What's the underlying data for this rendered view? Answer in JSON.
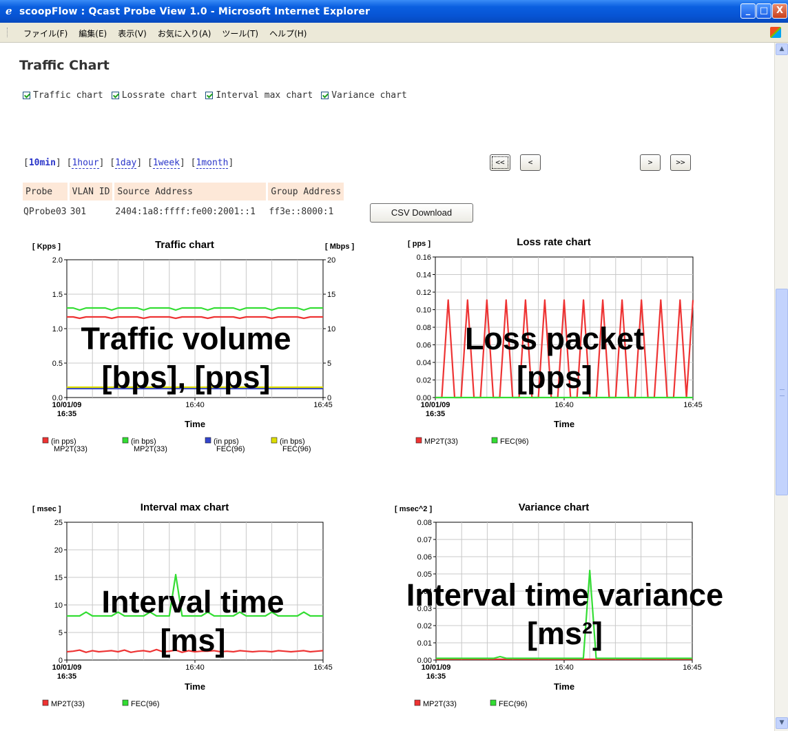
{
  "window": {
    "title": "scoopFlow : Qcast Probe View 1.0 - Microsoft Internet Explorer",
    "buttons": {
      "minimize": "_",
      "maximize": "□",
      "close": "X"
    }
  },
  "menu": [
    "ファイル(F)",
    "編集(E)",
    "表示(V)",
    "お気に入り(A)",
    "ツール(T)",
    "ヘルプ(H)"
  ],
  "page_title": "Traffic Chart",
  "checkboxes": [
    {
      "label": "Traffic chart",
      "checked": true
    },
    {
      "label": "Lossrate chart",
      "checked": true
    },
    {
      "label": "Interval max chart",
      "checked": true
    },
    {
      "label": "Variance chart",
      "checked": true
    }
  ],
  "periods": [
    {
      "label": "10min",
      "active": true
    },
    {
      "label": "1hour",
      "active": false
    },
    {
      "label": "1day",
      "active": false
    },
    {
      "label": "1week",
      "active": false
    },
    {
      "label": "1month",
      "active": false
    }
  ],
  "nav_buttons": [
    "<<",
    "<",
    ">",
    ">>"
  ],
  "table": {
    "headers": [
      "Probe",
      "VLAN ID",
      "Source Address",
      "Group Address"
    ],
    "row": [
      "QProbe03",
      "301",
      "2404:1a8:ffff:fe00:2001::1",
      "ff3e::8000:1"
    ]
  },
  "csv_button": "CSV Download",
  "overlays": {
    "traffic": [
      "Traffic volume",
      "[bps], [pps]"
    ],
    "loss": [
      "Loss packet",
      "[pps]"
    ],
    "interval": [
      "Interval time",
      "[ms]"
    ],
    "variance": [
      "Interval time variance",
      "[ms²]"
    ]
  },
  "chart_data": [
    {
      "type": "line",
      "title": "Traffic chart",
      "ylabel": "[ Kpps ]",
      "y2label": "[ Mbps ]",
      "xlabel": "Time",
      "x_ticks": [
        "10/01/09\n16:35",
        "16:40",
        "16:45"
      ],
      "ylim": [
        0,
        2.0
      ],
      "y_ticks": [
        "0.0",
        "0.5",
        "1.0",
        "1.5",
        "2.0"
      ],
      "y2lim": [
        0,
        20
      ],
      "y2_ticks": [
        "0",
        "5",
        "10",
        "15",
        "20"
      ],
      "grid": true,
      "legend": [
        "(in pps)\nMP2T(33)",
        "(in bps)\nMP2T(33)",
        "(in pps)\nFEC(96)",
        "(in bps)\nFEC(96)"
      ],
      "series": [
        {
          "name": "(in pps) MP2T(33)",
          "color": "#ee3333",
          "axis": "left",
          "values": [
            1.17,
            1.17,
            1.15,
            1.17,
            1.17,
            1.17,
            1.17,
            1.15,
            1.17,
            1.17,
            1.17,
            1.17,
            1.15,
            1.17,
            1.17,
            1.17,
            1.17,
            1.15,
            1.17,
            1.17,
            1.17,
            1.17,
            1.15,
            1.17,
            1.17,
            1.17,
            1.17,
            1.15,
            1.17,
            1.17,
            1.17,
            1.17,
            1.15,
            1.17,
            1.17,
            1.17,
            1.17,
            1.15,
            1.17,
            1.17,
            1.17
          ]
        },
        {
          "name": "(in bps) MP2T(33)",
          "color": "#33dd33",
          "axis": "right",
          "values": [
            13.0,
            13.0,
            12.7,
            13.0,
            13.0,
            13.0,
            13.0,
            12.7,
            13.0,
            13.0,
            13.0,
            13.0,
            12.7,
            13.0,
            13.0,
            13.0,
            13.0,
            12.7,
            13.0,
            13.0,
            13.0,
            13.0,
            12.7,
            13.0,
            13.0,
            13.0,
            13.0,
            12.7,
            13.0,
            13.0,
            13.0,
            13.0,
            12.7,
            13.0,
            13.0,
            13.0,
            13.0,
            12.7,
            13.0,
            13.0,
            13.0
          ]
        },
        {
          "name": "(in pps) FEC(96)",
          "color": "#3344cc",
          "axis": "left",
          "values": [
            0.13,
            0.13,
            0.13,
            0.13,
            0.13,
            0.13,
            0.13,
            0.13,
            0.13,
            0.13,
            0.13,
            0.13,
            0.13,
            0.13,
            0.13,
            0.13,
            0.13,
            0.13,
            0.13,
            0.13,
            0.13,
            0.13,
            0.13,
            0.13,
            0.13,
            0.13,
            0.13,
            0.13,
            0.13,
            0.13,
            0.13,
            0.13,
            0.13,
            0.13,
            0.13,
            0.13,
            0.13,
            0.13,
            0.13,
            0.13,
            0.13
          ]
        },
        {
          "name": "(in bps) FEC(96)",
          "color": "#dddd00",
          "axis": "right",
          "values": [
            1.5,
            1.5,
            1.5,
            1.5,
            1.5,
            1.5,
            1.5,
            1.5,
            1.5,
            1.5,
            1.5,
            1.5,
            1.5,
            1.5,
            1.5,
            1.5,
            1.5,
            1.5,
            1.5,
            1.5,
            1.5,
            1.5,
            1.5,
            1.5,
            1.5,
            1.5,
            1.5,
            1.5,
            1.5,
            1.5,
            1.5,
            1.5,
            1.5,
            1.5,
            1.5,
            1.5,
            1.5,
            1.5,
            1.5,
            1.5,
            1.5
          ]
        }
      ]
    },
    {
      "type": "line",
      "title": "Loss rate chart",
      "ylabel": "[ pps ]",
      "xlabel": "Time",
      "x_ticks": [
        "10/01/09\n16:35",
        "16:40",
        "16:45"
      ],
      "ylim": [
        0,
        0.16
      ],
      "y_ticks": [
        "0.00",
        "0.02",
        "0.04",
        "0.06",
        "0.08",
        "0.10",
        "0.12",
        "0.14",
        "0.16"
      ],
      "grid": true,
      "legend": [
        "MP2T(33)",
        "FEC(96)"
      ],
      "series": [
        {
          "name": "MP2T(33)",
          "color": "#ee3333",
          "values": [
            0,
            0,
            0.111,
            0,
            0,
            0.111,
            0,
            0,
            0.111,
            0,
            0,
            0.111,
            0,
            0,
            0.111,
            0,
            0,
            0.111,
            0,
            0,
            0.111,
            0,
            0,
            0.111,
            0,
            0,
            0.111,
            0,
            0,
            0.111,
            0,
            0,
            0.111,
            0,
            0,
            0.111,
            0,
            0,
            0.111,
            0,
            0.111
          ]
        },
        {
          "name": "FEC(96)",
          "color": "#33dd33",
          "values": [
            0,
            0,
            0,
            0,
            0,
            0,
            0,
            0,
            0,
            0,
            0,
            0,
            0,
            0,
            0,
            0,
            0,
            0,
            0,
            0,
            0,
            0,
            0,
            0,
            0,
            0,
            0,
            0,
            0,
            0,
            0,
            0,
            0,
            0,
            0,
            0,
            0,
            0,
            0,
            0,
            0
          ]
        }
      ]
    },
    {
      "type": "line",
      "title": "Interval max chart",
      "ylabel": "[ msec ]",
      "xlabel": "Time",
      "x_ticks": [
        "10/01/09\n16:35",
        "16:40",
        "16:45"
      ],
      "ylim": [
        0,
        25
      ],
      "y_ticks": [
        "0",
        "5",
        "10",
        "15",
        "20",
        "25"
      ],
      "grid": true,
      "legend": [
        "MP2T(33)",
        "FEC(96)"
      ],
      "series": [
        {
          "name": "MP2T(33)",
          "color": "#ee3333",
          "values": [
            1.5,
            1.6,
            1.8,
            1.4,
            1.7,
            1.5,
            1.6,
            1.7,
            1.5,
            1.8,
            1.4,
            1.6,
            1.7,
            1.5,
            1.9,
            1.5,
            1.6,
            1.8,
            1.4,
            1.7,
            1.5,
            1.6,
            1.6,
            1.7,
            1.5,
            1.6,
            1.5,
            1.7,
            1.6,
            1.5,
            1.6,
            1.6,
            1.5,
            1.7,
            1.6,
            1.5,
            1.6,
            1.7,
            1.5,
            1.6,
            1.7
          ]
        },
        {
          "name": "FEC(96)",
          "color": "#33dd33",
          "values": [
            8.0,
            8.0,
            8.0,
            8.7,
            8.0,
            8.0,
            8.0,
            8.0,
            8.7,
            8.0,
            8.0,
            8.0,
            8.0,
            8.7,
            8.0,
            8.0,
            8.0,
            15.5,
            8.0,
            8.0,
            8.0,
            8.0,
            8.7,
            8.0,
            8.0,
            8.0,
            8.0,
            8.7,
            8.0,
            8.0,
            8.0,
            8.0,
            8.7,
            8.0,
            8.0,
            8.0,
            8.0,
            8.7,
            8.0,
            8.0,
            8.0
          ]
        }
      ]
    },
    {
      "type": "line",
      "title": "Variance chart",
      "ylabel": "[ msec^2 ]",
      "xlabel": "Time",
      "x_ticks": [
        "10/01/09\n16:35",
        "16:40",
        "16:45"
      ],
      "ylim": [
        0,
        0.08
      ],
      "y_ticks": [
        "0.00",
        "0.01",
        "0.02",
        "0.03",
        "0.04",
        "0.05",
        "0.06",
        "0.07",
        "0.08"
      ],
      "grid": true,
      "legend": [
        "MP2T(33)",
        "FEC(96)"
      ],
      "series": [
        {
          "name": "MP2T(33)",
          "color": "#ee3333",
          "values": [
            0.0005,
            0.0005,
            0.0005,
            0.0005,
            0.0005,
            0.0005,
            0.0005,
            0.0005,
            0.0005,
            0.0005,
            0.0005,
            0.0005,
            0.0005,
            0.0005,
            0.0005,
            0.0005,
            0.0005,
            0.0005,
            0.0005,
            0.0005,
            0.0005,
            0.0005,
            0.0005,
            0.0005,
            0.0005,
            0.0005,
            0.0005,
            0.0005,
            0.0005,
            0.0005,
            0.0005,
            0.0005,
            0.0005,
            0.0005,
            0.0005,
            0.0005,
            0.0005,
            0.0005,
            0.0005,
            0.0005,
            0.0005
          ]
        },
        {
          "name": "FEC(96)",
          "color": "#33dd33",
          "values": [
            0.001,
            0.001,
            0.001,
            0.001,
            0.001,
            0.001,
            0.001,
            0.001,
            0.001,
            0.001,
            0.002,
            0.001,
            0.001,
            0.001,
            0.001,
            0.001,
            0.001,
            0.001,
            0.001,
            0.001,
            0.001,
            0.001,
            0.001,
            0.001,
            0.052,
            0.001,
            0.001,
            0.001,
            0.001,
            0.001,
            0.001,
            0.001,
            0.001,
            0.001,
            0.001,
            0.001,
            0.001,
            0.001,
            0.001,
            0.001,
            0.001
          ]
        }
      ]
    }
  ]
}
